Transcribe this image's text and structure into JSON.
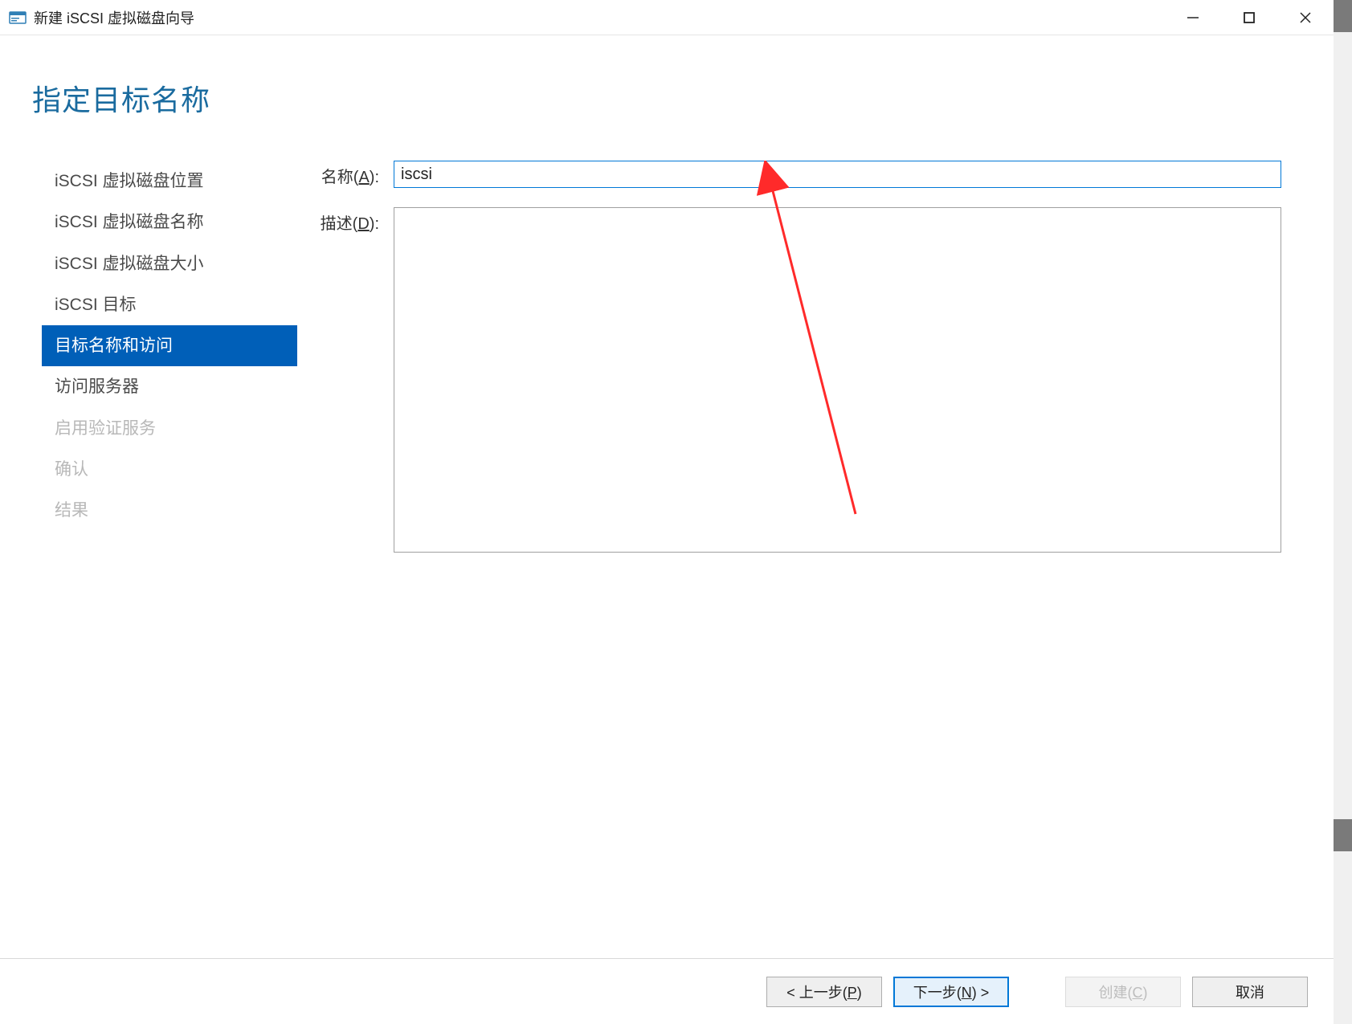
{
  "window": {
    "title": "新建 iSCSI 虚拟磁盘向导"
  },
  "heading": "指定目标名称",
  "sidebar": {
    "items": [
      {
        "label": "iSCSI 虚拟磁盘位置",
        "state": "normal"
      },
      {
        "label": "iSCSI 虚拟磁盘名称",
        "state": "normal"
      },
      {
        "label": "iSCSI 虚拟磁盘大小",
        "state": "normal"
      },
      {
        "label": "iSCSI 目标",
        "state": "normal"
      },
      {
        "label": "目标名称和访问",
        "state": "selected"
      },
      {
        "label": "访问服务器",
        "state": "normal"
      },
      {
        "label": "启用验证服务",
        "state": "disabled"
      },
      {
        "label": "确认",
        "state": "disabled"
      },
      {
        "label": "结果",
        "state": "disabled"
      }
    ]
  },
  "form": {
    "name_label_prefix": "名称(",
    "name_label_key": "A",
    "name_label_suffix": "):",
    "name_value": "iscsi",
    "desc_label_prefix": "描述(",
    "desc_label_key": "D",
    "desc_label_suffix": "):",
    "desc_value": ""
  },
  "footer": {
    "prev_prefix": "< 上一步(",
    "prev_key": "P",
    "prev_suffix": ")",
    "next_prefix": "下一步(",
    "next_key": "N",
    "next_suffix": ") >",
    "create_prefix": "创建(",
    "create_key": "C",
    "create_suffix": ")",
    "cancel": "取消"
  }
}
